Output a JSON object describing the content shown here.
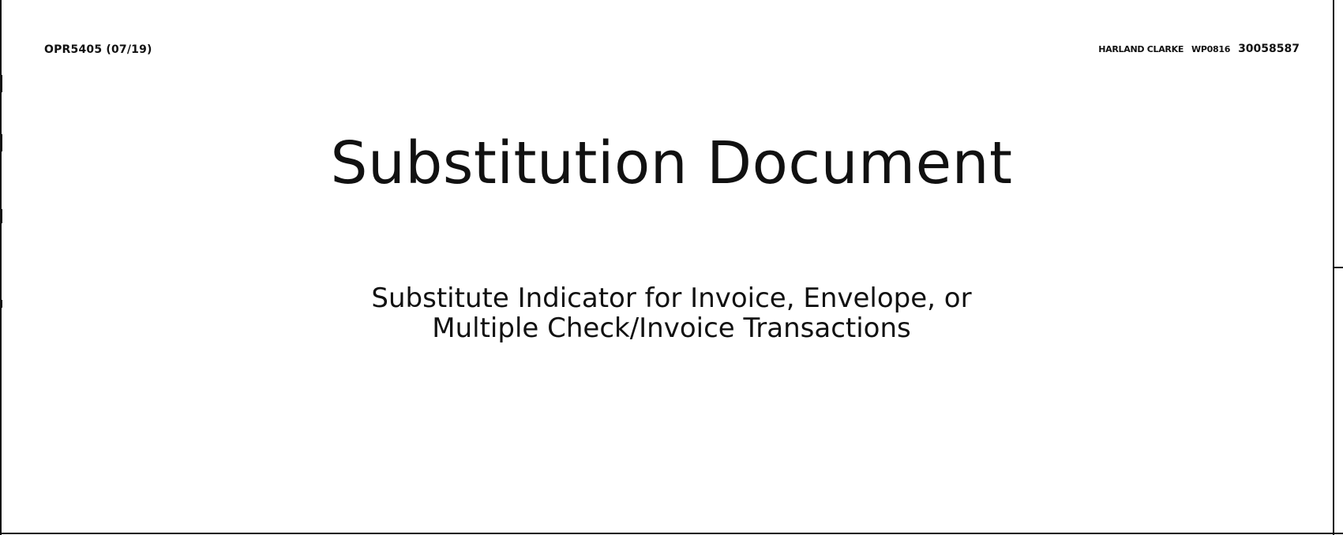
{
  "header": {
    "form_code": "OPR5405 (07/19)",
    "printer_name": "HARLAND CLARKE",
    "printer_code": "WP0816",
    "printer_number": "30058587"
  },
  "document": {
    "title": "Substitution Document",
    "subtitle_line1": "Substitute Indicator for Invoice, Envelope, or",
    "subtitle_line2": "Multiple Check/Invoice Transactions"
  }
}
